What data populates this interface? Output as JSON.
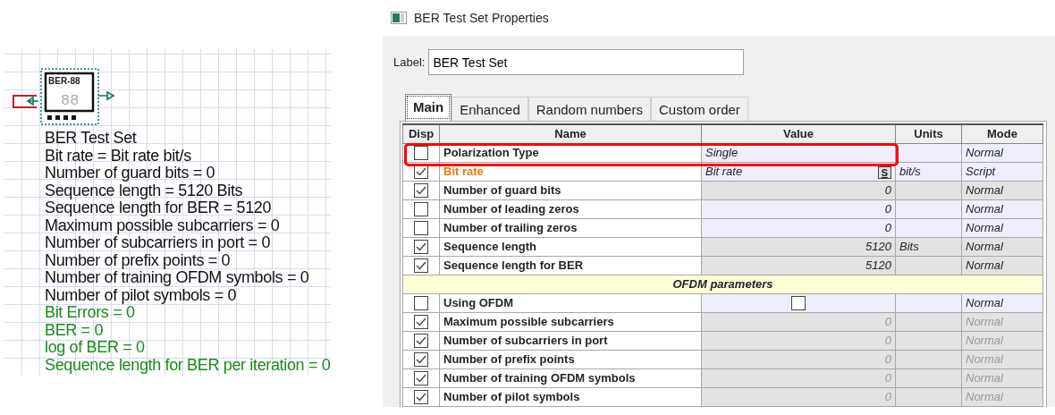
{
  "schematic": {
    "block": {
      "display_label": "BER-88",
      "display_digits": "88"
    },
    "lines": [
      {
        "text": "BER Test Set",
        "kind": "param"
      },
      {
        "text": "Bit rate = Bit rate  bit/s",
        "kind": "param"
      },
      {
        "text": "Number of guard bits = 0",
        "kind": "param"
      },
      {
        "text": "Sequence length = 5120  Bits",
        "kind": "param"
      },
      {
        "text": "Sequence length for BER = 5120",
        "kind": "param"
      },
      {
        "text": "Maximum possible subcarriers = 0",
        "kind": "param"
      },
      {
        "text": "Number of subcarriers in port = 0",
        "kind": "param"
      },
      {
        "text": "Number of prefix points = 0",
        "kind": "param"
      },
      {
        "text": "Number of training OFDM symbols = 0",
        "kind": "param"
      },
      {
        "text": "Number of pilot symbols = 0",
        "kind": "param"
      },
      {
        "text": "Bit Errors = 0",
        "kind": "result"
      },
      {
        "text": "BER = 0",
        "kind": "result"
      },
      {
        "text": "log of BER = 0",
        "kind": "result"
      },
      {
        "text": "Sequence length for BER per iteration = 0",
        "kind": "result"
      }
    ]
  },
  "window": {
    "title": "BER Test Set Properties"
  },
  "label_field": {
    "label": "Label:",
    "value": "BER Test Set"
  },
  "tabs": [
    {
      "label": "Main",
      "selected": true
    },
    {
      "label": "Enhanced",
      "selected": false
    },
    {
      "label": "Random numbers",
      "selected": false
    },
    {
      "label": "Custom order",
      "selected": false
    }
  ],
  "table": {
    "columns": [
      "Disp",
      "Name",
      "Value",
      "Units",
      "Mode"
    ],
    "rows": [
      {
        "kind": "text",
        "disp": false,
        "name": "Polarization Type",
        "value": "Single",
        "mode": "Normal",
        "editable": true,
        "disabled": false,
        "scripted": false,
        "highlighted": true
      },
      {
        "kind": "text",
        "disp": true,
        "name": "Bit rate",
        "value": "Bit rate",
        "script_button": "S",
        "units": "bit/s",
        "mode": "Script",
        "editable": true,
        "disabled": false,
        "scripted": true,
        "highlighted": false
      },
      {
        "kind": "number",
        "disp": true,
        "name": "Number of guard bits",
        "value": "0",
        "mode": "Normal",
        "editable": false,
        "disabled": false,
        "scripted": false,
        "highlighted": false
      },
      {
        "kind": "number",
        "disp": false,
        "name": "Number of leading zeros",
        "value": "0",
        "mode": "Normal",
        "editable": true,
        "disabled": false,
        "scripted": false,
        "highlighted": false
      },
      {
        "kind": "number",
        "disp": false,
        "name": "Number of trailing zeros",
        "value": "0",
        "mode": "Normal",
        "editable": true,
        "disabled": false,
        "scripted": false,
        "highlighted": false
      },
      {
        "kind": "number",
        "disp": true,
        "name": "Sequence length",
        "value": "5120",
        "units": "Bits",
        "mode": "Normal",
        "editable": false,
        "disabled": false,
        "scripted": false,
        "highlighted": false
      },
      {
        "kind": "number",
        "disp": true,
        "name": "Sequence length for BER",
        "value": "5120",
        "mode": "Normal",
        "editable": false,
        "disabled": false,
        "scripted": false,
        "highlighted": false
      },
      {
        "kind": "section",
        "title": "OFDM parameters"
      },
      {
        "kind": "checkbox",
        "disp": false,
        "name": "Using OFDM",
        "value_checked": false,
        "mode": "Normal",
        "editable": true,
        "disabled": false,
        "scripted": false,
        "highlighted": false
      },
      {
        "kind": "number",
        "disp": true,
        "name": "Maximum possible subcarriers",
        "value": "0",
        "mode": "Normal",
        "editable": false,
        "disabled": true,
        "scripted": false,
        "highlighted": false
      },
      {
        "kind": "number",
        "disp": true,
        "name": "Number of subcarriers in port",
        "value": "0",
        "mode": "Normal",
        "editable": false,
        "disabled": true,
        "scripted": false,
        "highlighted": false
      },
      {
        "kind": "number",
        "disp": true,
        "name": "Number of prefix points",
        "value": "0",
        "mode": "Normal",
        "editable": false,
        "disabled": true,
        "scripted": false,
        "highlighted": false
      },
      {
        "kind": "number",
        "disp": true,
        "name": "Number of training OFDM symbols",
        "value": "0",
        "mode": "Normal",
        "editable": false,
        "disabled": true,
        "scripted": false,
        "highlighted": false
      },
      {
        "kind": "number",
        "disp": true,
        "name": "Number of pilot symbols",
        "value": "0",
        "mode": "Normal",
        "editable": false,
        "disabled": true,
        "scripted": false,
        "highlighted": false
      }
    ]
  }
}
